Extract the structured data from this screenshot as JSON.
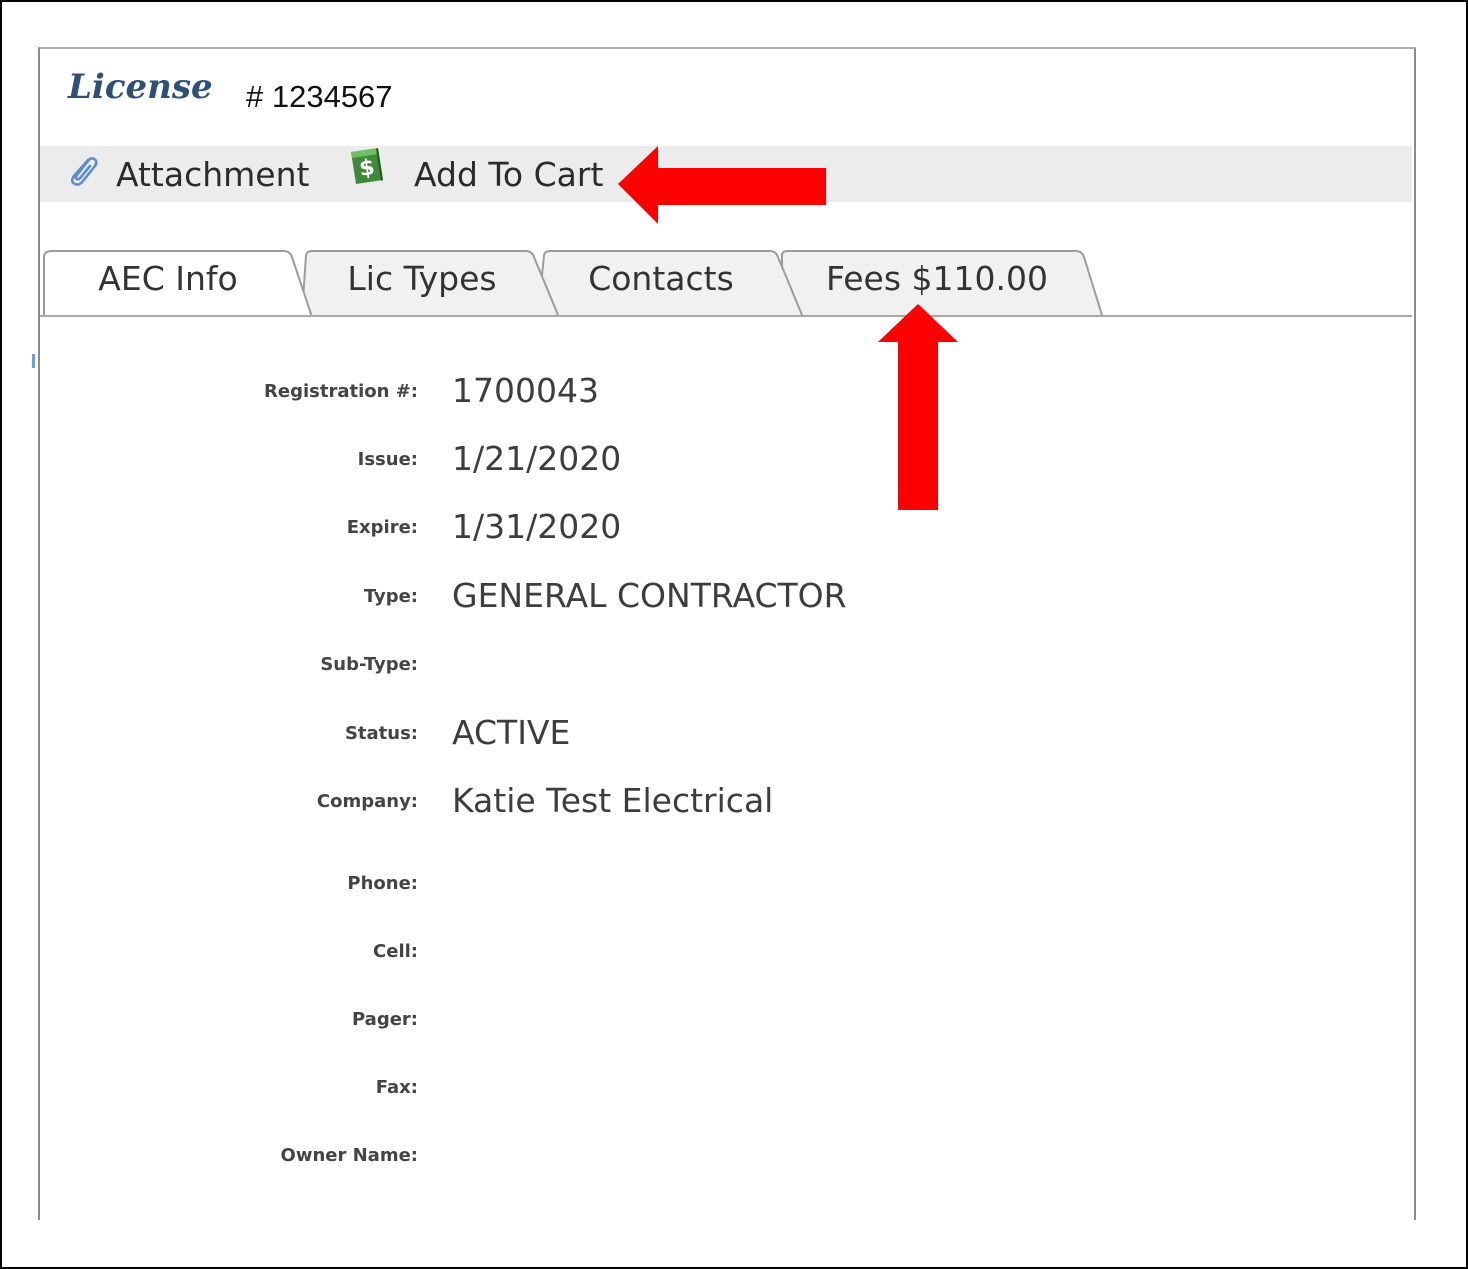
{
  "header": {
    "title_word": "License",
    "license_number": "# 1234567"
  },
  "toolbar": {
    "attachment_label": "Attachment",
    "add_to_cart_label": "Add To Cart"
  },
  "tabs": [
    {
      "label": "AEC Info",
      "active": true
    },
    {
      "label": "Lic Types",
      "active": false
    },
    {
      "label": "Contacts",
      "active": false
    },
    {
      "label": "Fees $110.00",
      "active": false
    }
  ],
  "fields": [
    {
      "label": "Registration #:",
      "value": "1700043"
    },
    {
      "label": "Issue:",
      "value": "1/21/2020"
    },
    {
      "label": "Expire:",
      "value": "1/31/2020"
    },
    {
      "label": "Type:",
      "value": "GENERAL CONTRACTOR"
    },
    {
      "label": "Sub-Type:",
      "value": ""
    },
    {
      "label": "Status:",
      "value": "ACTIVE"
    },
    {
      "label": "Company:",
      "value": "Katie Test Electrical"
    },
    {
      "label": "Phone:",
      "value": ""
    },
    {
      "label": "Cell:",
      "value": ""
    },
    {
      "label": "Pager:",
      "value": ""
    },
    {
      "label": "Fax:",
      "value": ""
    },
    {
      "label": "Owner Name:",
      "value": ""
    }
  ],
  "icons": {
    "attachment": "paperclip-icon",
    "add_to_cart": "dollar-sign-icon"
  },
  "colors": {
    "title": "#2f4f75",
    "toolbar_bg": "#ececec",
    "icon_green": "#3e8a3a",
    "clip_blue": "#5b8ccc",
    "annotation_red": "#ff0000",
    "tab_inactive": "#f1f1f1",
    "tab_active": "#ffffff"
  }
}
